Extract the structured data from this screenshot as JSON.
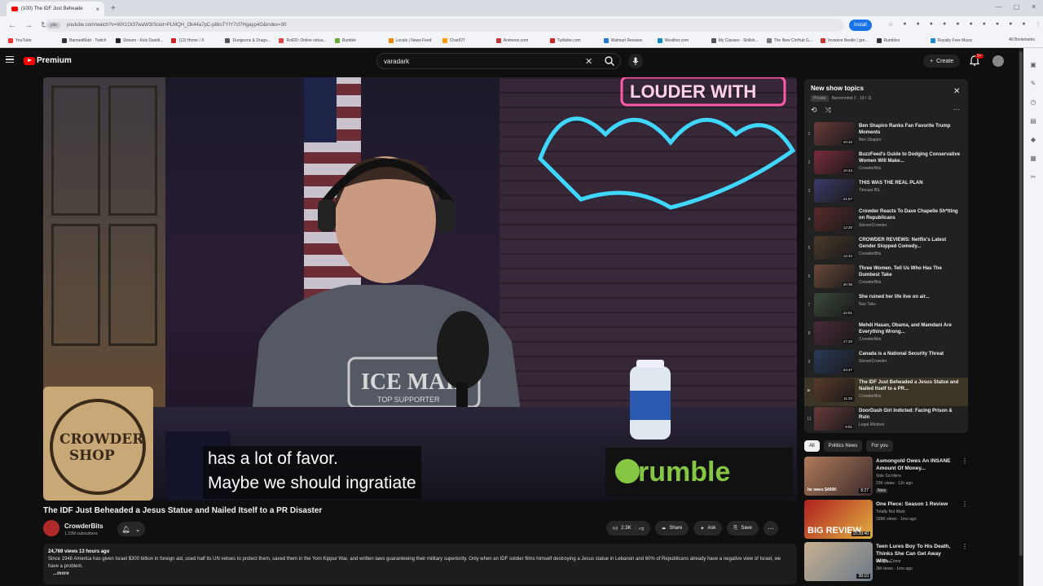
{
  "browser": {
    "tab_title": "(100) The IDF Just Beheade",
    "new_tab": "+",
    "url_site": "yds",
    "url": "youtube.com/watch?v=WX1OI37waW3rSciet+PLMQH_Ok44a7pC-p8ksTYIY7cf7Hgayp4G&index=30",
    "install_label": "Install",
    "bookmarks": [
      "YouTube",
      "BannedMatt - Twitch",
      "Stream - Kick Davidi...",
      "(13) Home / X",
      "Dungeons & Drago...",
      "Roll20: Online virtua...",
      "Rumble",
      "Locals | News Feed",
      "CharIOT",
      "Animeon.com",
      "Turtlebe.com",
      "Walmart Reviews",
      "Weather.com",
      "My Classes - Skillsh...",
      "The New CinHub G...",
      "Invasive Beetle | gre...",
      "Rumbles",
      "Royalty Free Music"
    ],
    "all_bookmarks": "All Bookmarks"
  },
  "yt": {
    "logo_text": "Premium",
    "search_value": "varadark",
    "create_label": "Create",
    "notif_count": "9+"
  },
  "video": {
    "subtitle_lines": [
      "has a lot of favor.",
      "Maybe we should ingratiate"
    ],
    "title": "The IDF Just Beheaded a Jesus Statue and Nailed Itself to a PR Disaster",
    "channel": "CrowderBits",
    "subscribers": "1.33M subscribers",
    "likes": "2.3K",
    "share_label": "Share",
    "ask_label": "Ask",
    "save_label": "Save",
    "views_meta": "24,769 views  13 hours ago",
    "description": "Since 1948 America has given Israel $300 billion in foreign aid, used half its UN vetoes to protect them, saved them in the Yom Kippur War, and written laws guaranteeing their military superiority. Only when an IDF soldier films himself destroying a Jesus statue in Lebanon and 60% of Republicans already have a negative view of Israel, we have a problem.",
    "more_label": "...more",
    "scene": {
      "shop_sign": "CROWDER SHOP",
      "shirt": "ICE MAID",
      "shirt_sub": "TOP SUPPORTER",
      "neon": "LOUDER WITH Crowder",
      "rumble": "rumble"
    }
  },
  "playlist": {
    "title": "New show topics",
    "privacy": "Private",
    "owner_progress": "Barrenmind 2 · 10 / 11",
    "items": [
      {
        "idx": "1",
        "title": "Ben Shapiro Ranks Fan Favorite Trump Moments",
        "channel": "Ben Shapiro",
        "duration": "10:12"
      },
      {
        "idx": "2",
        "title": "BuzzFeed's Guide to Dodging Conservative Women Will Make...",
        "channel": "CrowderBits",
        "duration": "10:43"
      },
      {
        "idx": "3",
        "title": "THIS WAS THE REAL PLAN",
        "channel": "Timcast IRL",
        "duration": "21:57"
      },
      {
        "idx": "4",
        "title": "Crowder Reacts To Dave Chapelle Sh*tting on Republicans",
        "channel": "StevenCrowder",
        "duration": "12:20"
      },
      {
        "idx": "5",
        "title": "CROWDER REVIEWS: Netflix's Latest Gender Slopped Comedy...",
        "channel": "CrowderBits",
        "duration": "14:42"
      },
      {
        "idx": "6",
        "title": "Three Women. Tell Us Who Has The Dumbest Take",
        "channel": "CrowderBits",
        "duration": "20:36"
      },
      {
        "idx": "7",
        "title": "She ruined her life live on air...",
        "channel": "Nuz Taku",
        "duration": "22:01"
      },
      {
        "idx": "8",
        "title": "Mehdi Hasan, Obama, and Mamdani Are Everything Wrong...",
        "channel": "CrowderBits",
        "duration": "17:33"
      },
      {
        "idx": "9",
        "title": "Canada is a National Security Threat",
        "channel": "StevenCrowder",
        "duration": "23:47"
      },
      {
        "idx": "▶",
        "title": "The IDF Just Beheaded a Jesus Statue and Nailed Itself to a PR...",
        "channel": "CrowderBits",
        "duration": "11:33"
      },
      {
        "idx": "11",
        "title": "DoorDash Girl Indicted: Facing Prison & Ruin",
        "channel": "Legal Mindset",
        "duration": "9:01"
      }
    ]
  },
  "chips": [
    "All",
    "Politics News",
    "For you"
  ],
  "recommendations": [
    {
      "title": "Asmongold Owes An INSANE Amount Of Money...",
      "channel": "Side Scrollers",
      "stats": "23K views · 11h ago",
      "badge": "New",
      "duration": "8:27",
      "thumb_text": "he owes $400K"
    },
    {
      "title": "One Piece: Season 1 Review",
      "channel": "Totally Not Mark",
      "stats": "339K views · 1mo ago",
      "badge": "",
      "duration": "15:20:40",
      "thumb_text": "BIG REVIEW"
    },
    {
      "title": "Teen Lures Boy To His Death, Thinks She Can Get Away With...",
      "channel": "Dangie Crime",
      "stats": "3M views · 1mo ago",
      "badge": "",
      "duration": "38:10",
      "thumb_text": ""
    }
  ]
}
